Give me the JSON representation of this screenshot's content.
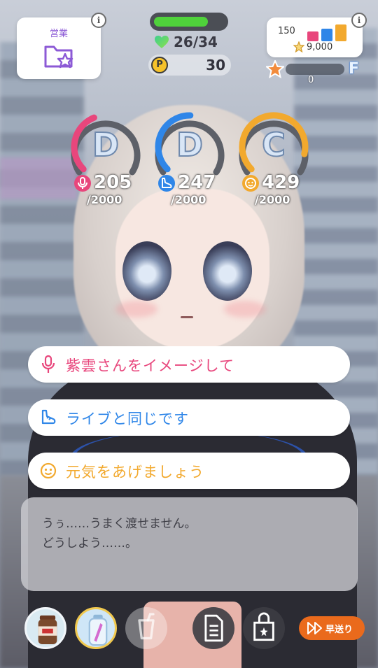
{
  "hud": {
    "work_label": "営業",
    "stamina": {
      "current": 26,
      "max": 34,
      "text": "26/34",
      "fill_fraction": 0.77,
      "color": "#4fd23b"
    },
    "p_coin": {
      "icon_letter": "P",
      "value": "30"
    },
    "fans": {
      "count": "150",
      "total": "9,000"
    },
    "rank": {
      "letter": "F",
      "count": "0",
      "progress_fraction": 0.0
    }
  },
  "stats": [
    {
      "name": "vocal",
      "grade": "D",
      "value": "205",
      "max": "/2000",
      "color": "#e8467c",
      "gauge_fraction": 0.1,
      "icon": "microphone-icon"
    },
    {
      "name": "dance",
      "grade": "D",
      "value": "247",
      "max": "/2000",
      "color": "#2f86e8",
      "gauge_fraction": 0.12,
      "icon": "shoe-icon"
    },
    {
      "name": "visual",
      "grade": "C",
      "value": "429",
      "max": "/2000",
      "color": "#f2a92e",
      "gauge_fraction": 0.21,
      "icon": "face-icon"
    }
  ],
  "choices": [
    {
      "text": "紫雲さんをイメージして",
      "color": "#e8467c",
      "icon": "microphone-icon"
    },
    {
      "text": "ライブと同じです",
      "color": "#2f86e8",
      "icon": "shoe-icon"
    },
    {
      "text": "元気をあげましょう",
      "color": "#f2a92e",
      "icon": "face-icon"
    }
  ],
  "dialogue": {
    "line1": "うぅ……うまく渡せません。",
    "line2": "どうしよう……。"
  },
  "bottom": {
    "fast_forward_label": "早送り"
  }
}
